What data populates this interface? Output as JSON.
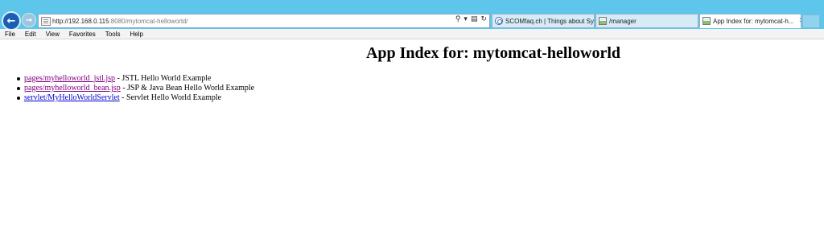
{
  "browser": {
    "address": {
      "prefix": "http://192.168.0.115",
      "suffix": ":8080/mytomcat-helloworld/",
      "tools": {
        "search": "⚲",
        "dropdown": "▾",
        "compat": "▤",
        "refresh": "↻"
      }
    },
    "tabs": [
      {
        "label": "SCOMfaq.ch | Things about Sy...",
        "icon": "globe-icon"
      },
      {
        "label": "/manager",
        "icon": "image-icon"
      },
      {
        "label": "App Index for: mytomcat-h...",
        "icon": "image-icon",
        "close": "✕"
      }
    ],
    "menu": [
      "File",
      "Edit",
      "View",
      "Favorites",
      "Tools",
      "Help"
    ],
    "nav": {
      "back": "←",
      "forward": "→"
    }
  },
  "page": {
    "title": "App Index for: mytomcat-helloworld",
    "items": [
      {
        "link": "pages/myhelloworld_jstl.jsp",
        "desc": " - JSTL Hello World Example",
        "visited": true
      },
      {
        "link": "pages/myhelloworld_bean.jsp",
        "desc": " - JSP & Java Bean Hello World Example",
        "visited": true
      },
      {
        "link": "servlet/MyHelloWorldServlet",
        "desc": " - Servlet Hello World Example",
        "visited": false
      }
    ]
  },
  "colors": {
    "titlebar": "#5ec6ea",
    "visited_link": "#800080",
    "link": "#0000cc"
  }
}
